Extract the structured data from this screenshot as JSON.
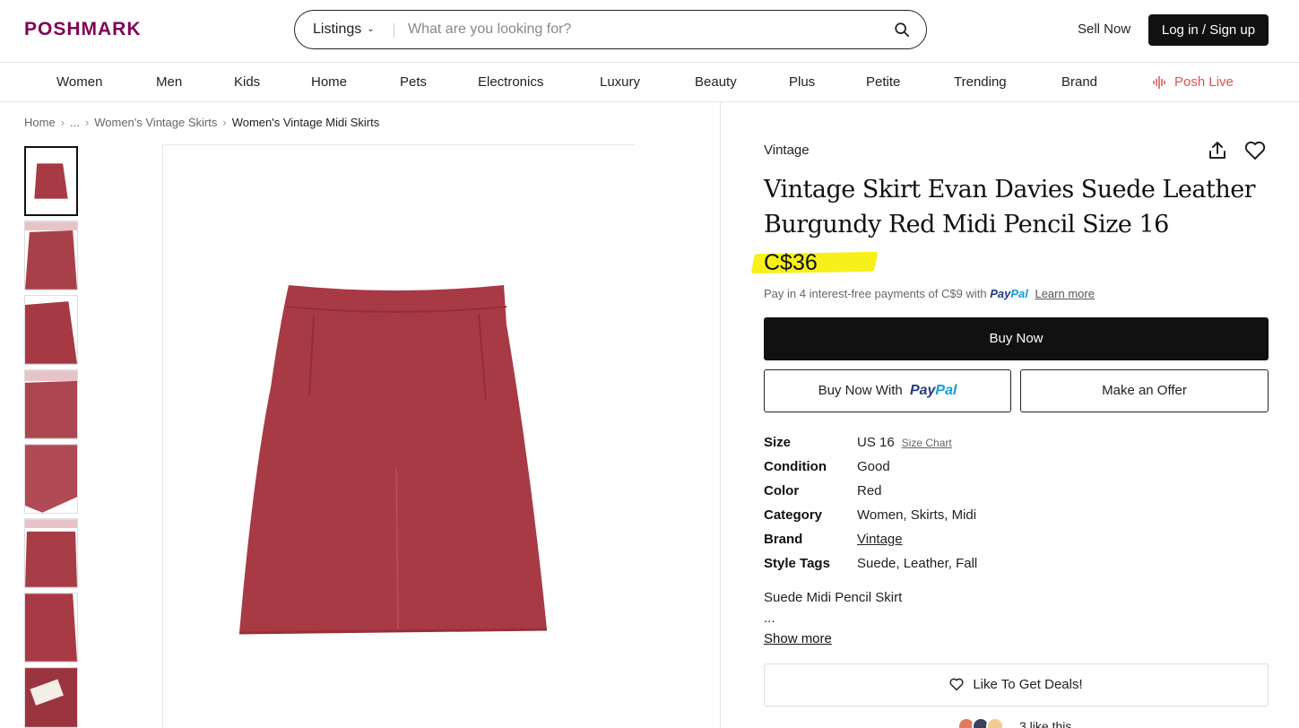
{
  "header": {
    "logo": "POSHMARK",
    "search_category": "Listings",
    "search_placeholder": "What are you looking for?",
    "sell_now": "Sell Now",
    "login": "Log in / Sign up"
  },
  "nav": [
    "Women",
    "Men",
    "Kids",
    "Home",
    "Pets",
    "Electronics",
    "Luxury",
    "Beauty",
    "Plus",
    "Petite",
    "Trending",
    "Brand",
    "Posh Live"
  ],
  "breadcrumb": {
    "home": "Home",
    "ellipsis": "...",
    "level2": "Women's Vintage Skirts",
    "current": "Women's Vintage Midi Skirts"
  },
  "product": {
    "brand_label": "Vintage",
    "title": "Vintage Skirt Evan Davies Suede Leather Burgundy Red Midi Pencil Size 16",
    "price": "C$36",
    "installments_text": "Pay in 4 interest-free payments of C$9 with",
    "paypal_pay": "Pay",
    "paypal_pal": "Pal",
    "learn_more": "Learn more",
    "buy_now": "Buy Now",
    "buy_now_with": "Buy Now With",
    "make_offer": "Make an Offer",
    "attributes": [
      {
        "key": "Size",
        "value": "US 16",
        "extra": "Size Chart"
      },
      {
        "key": "Condition",
        "value": "Good"
      },
      {
        "key": "Color",
        "value": "Red"
      },
      {
        "key": "Category",
        "value": "Women, Skirts, Midi"
      },
      {
        "key": "Brand",
        "value": "Vintage"
      },
      {
        "key": "Style Tags",
        "value": "Suede, Leather, Fall"
      }
    ],
    "description": "Suede Midi Pencil Skirt",
    "description_more": "...",
    "show_more": "Show more",
    "like_deals": "Like To Get Deals!",
    "likes_text": "3 like this"
  },
  "colors": {
    "brand": "#7f0353",
    "highlight": "#f7f01a",
    "skirt": "#a83a45",
    "live": "#d9534f"
  }
}
